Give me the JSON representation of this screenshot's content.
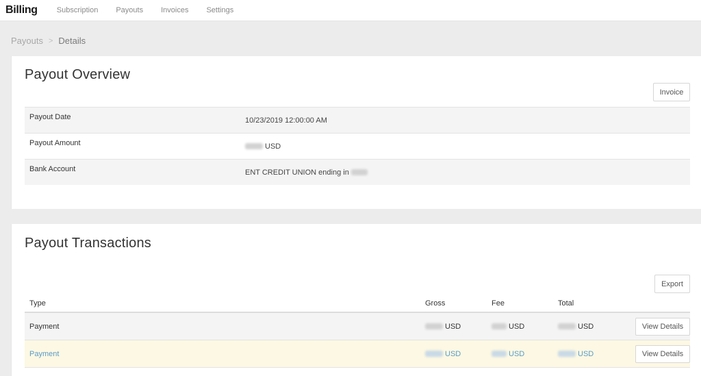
{
  "nav": {
    "brand": "Billing",
    "links": [
      "Subscription",
      "Payouts",
      "Invoices",
      "Settings"
    ]
  },
  "breadcrumb": {
    "parent": "Payouts",
    "separator": ">",
    "current": "Details"
  },
  "overview": {
    "title": "Payout Overview",
    "invoice_button": "Invoice",
    "rows": [
      {
        "label": "Payout Date",
        "value": "10/23/2019 12:00:00 AM"
      },
      {
        "label": "Payout Amount",
        "value": "USD"
      },
      {
        "label": "Bank Account",
        "value": "ENT CREDIT UNION ending in"
      }
    ]
  },
  "transactions": {
    "title": "Payout Transactions",
    "export_button": "Export",
    "columns": {
      "type": "Type",
      "gross": "Gross",
      "fee": "Fee",
      "total": "Total"
    },
    "rows": [
      {
        "type": "Payment",
        "gross_unit": "USD",
        "fee_unit": "USD",
        "total_unit": "USD",
        "action": "View Details"
      },
      {
        "type": "Payment",
        "gross_unit": "USD",
        "fee_unit": "USD",
        "total_unit": "USD",
        "action": "View Details"
      }
    ]
  },
  "colors": {
    "highlight_row": "#fcf8e3",
    "link_blue": "#5a9bc8",
    "background": "#ececec"
  }
}
